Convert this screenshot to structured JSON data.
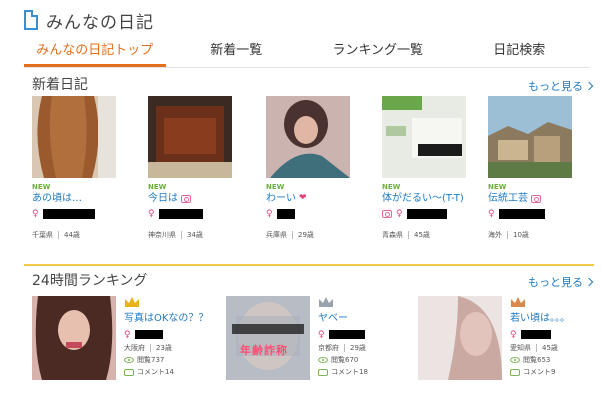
{
  "header": {
    "title": "みんなの日記"
  },
  "tabs": [
    {
      "label": "みんなの日記トップ",
      "active": true
    },
    {
      "label": "新着一覧",
      "active": false
    },
    {
      "label": "ランキング一覧",
      "active": false
    },
    {
      "label": "日記検索",
      "active": false
    }
  ],
  "new_diary": {
    "title": "新着日記",
    "more": "もっと見る",
    "items": [
      {
        "badge": "NEW",
        "title": "あの頃は…",
        "has_camera": false,
        "pref": "千葉県",
        "age": "44歳"
      },
      {
        "badge": "NEW",
        "title": "今日は",
        "has_camera": true,
        "pref": "神奈川県",
        "age": "34歳"
      },
      {
        "badge": "NEW",
        "title": "わーい",
        "has_camera": false,
        "pref": "兵庫県",
        "age": "29歳"
      },
      {
        "badge": "NEW",
        "title": "体がだるい〜(T-T)",
        "has_camera": true,
        "pref": "青森県",
        "age": "45歳"
      },
      {
        "badge": "NEW",
        "title": "伝統工芸",
        "has_camera": true,
        "pref": "海外",
        "age": "10歳"
      }
    ]
  },
  "ranking": {
    "title": "24時間ランキング",
    "more": "もっと見る",
    "items": [
      {
        "rank": 1,
        "title": "写真はOKなの？？",
        "pref": "大阪府",
        "age": "23歳",
        "views": "閲覧737",
        "comments": "コメント14",
        "crown_color": "#e7b21a"
      },
      {
        "rank": 2,
        "title": "ヤベー",
        "pref": "京都府",
        "age": "29歳",
        "views": "閲覧670",
        "comments": "コメント18",
        "crown_color": "#9aa3ad",
        "overlay": "年齢詐称"
      },
      {
        "rank": 3,
        "title": "若い頃は。。。",
        "pref": "愛知県",
        "age": "45歳",
        "views": "閲覧653",
        "comments": "コメント9",
        "crown_color": "#d98a4a"
      }
    ]
  }
}
